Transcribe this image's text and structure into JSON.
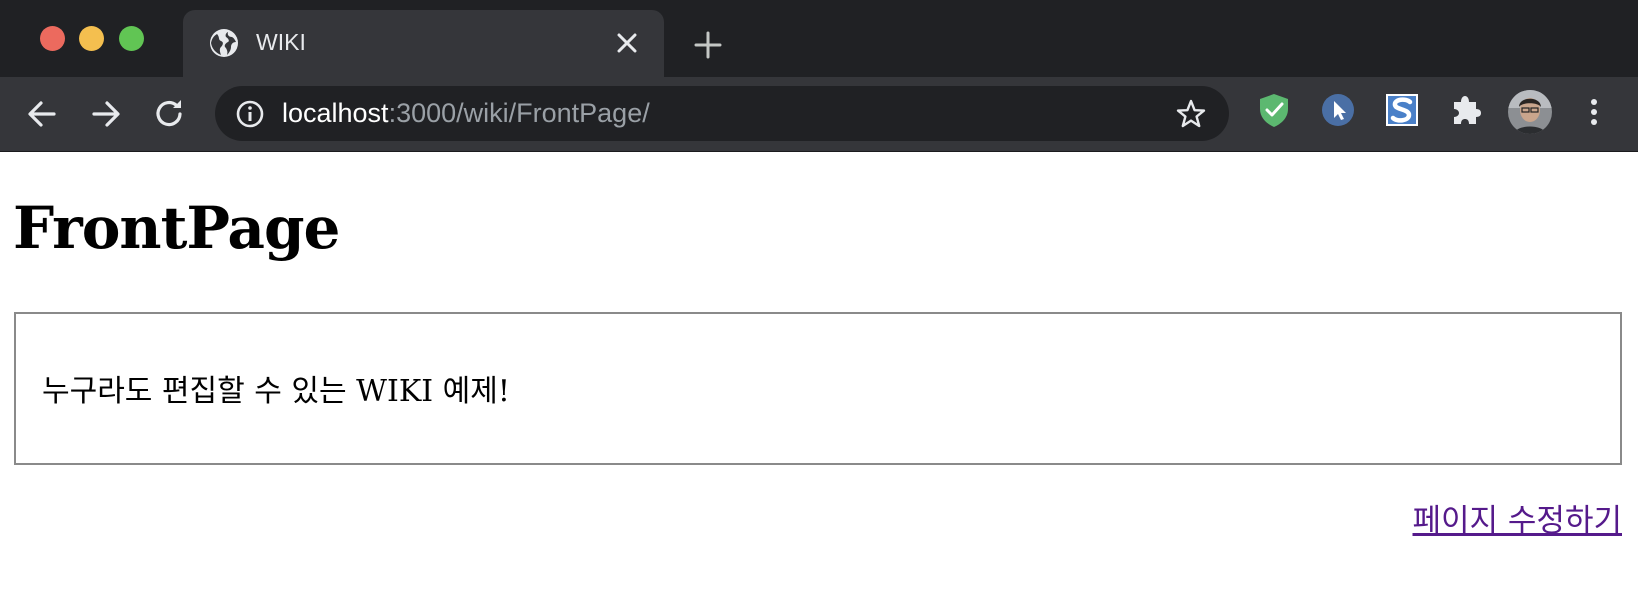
{
  "browser": {
    "tab": {
      "title": "WIKI",
      "icon": "globe-icon"
    },
    "address": {
      "host": "localhost",
      "path": ":3000/wiki/FrontPage/"
    },
    "icons": {
      "back": "arrow-left-icon",
      "forward": "arrow-right-icon",
      "reload": "reload-icon",
      "info": "info-icon",
      "bookmark": "star-icon",
      "new_tab": "plus-icon",
      "extensions": [
        "shield-check-icon",
        "cursor-icon",
        "s-logo-icon",
        "puzzle-icon"
      ],
      "menu": "kebab-menu-icon"
    },
    "colors": {
      "frame": "#202124",
      "toolbar": "#35363a",
      "text": "#e8eaed",
      "url_muted": "#9aa0a6"
    }
  },
  "page": {
    "title": "FrontPage",
    "body": "누구라도 편집할 수 있는 WIKI 예제!",
    "edit_link": "페이지 수정하기",
    "colors": {
      "link_visited": "#551a8b",
      "box_border": "#8a8a8a"
    }
  }
}
